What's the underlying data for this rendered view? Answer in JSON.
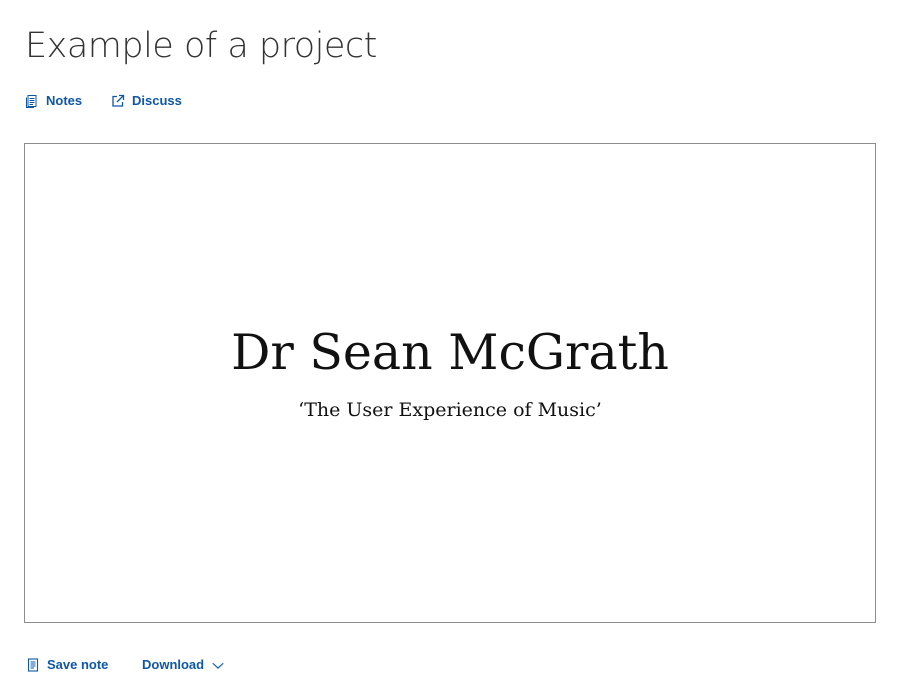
{
  "page": {
    "title": "Example of a project"
  },
  "actions": {
    "notes_label": "Notes",
    "discuss_label": "Discuss",
    "notes_icon": "document-icon",
    "discuss_icon": "external-link-icon"
  },
  "slide": {
    "author": "Dr Sean McGrath",
    "subtitle": "‘The User Experience of Music’"
  },
  "footer": {
    "save_note_label": "Save note",
    "download_label": "Download",
    "save_note_icon": "document-icon",
    "download_icon": "chevron-down-icon"
  },
  "colors": {
    "link": "#0e57a8",
    "title": "#333333",
    "frame_border": "#8c8c8c"
  }
}
